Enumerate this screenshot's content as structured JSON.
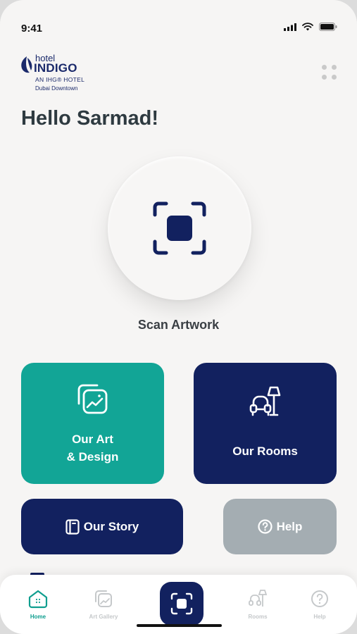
{
  "status_bar": {
    "time": "9:41"
  },
  "logo": {
    "hotel": "hotel",
    "indigo": "INDIGO",
    "ihg_line": "AN IHG® HOTEL",
    "location": "Dubai Downtown"
  },
  "greeting": "Hello Sarmad!",
  "scan": {
    "label": "Scan Artwork"
  },
  "cards": {
    "art_line1": "Our Art",
    "art_line2": "& Design",
    "rooms": "Our Rooms",
    "story": "Our Story",
    "help": "Help"
  },
  "nav": {
    "home": "Home",
    "gallery": "Art Gallery",
    "rooms": "Rooms",
    "help": "Help",
    "active": "Home"
  },
  "colors": {
    "teal": "#12a596",
    "navy": "#12215f",
    "grey_card": "#a4adb2",
    "background": "#f6f5f4",
    "nav_active": "#0f9e8f",
    "nav_inactive": "#c5c8ca"
  }
}
